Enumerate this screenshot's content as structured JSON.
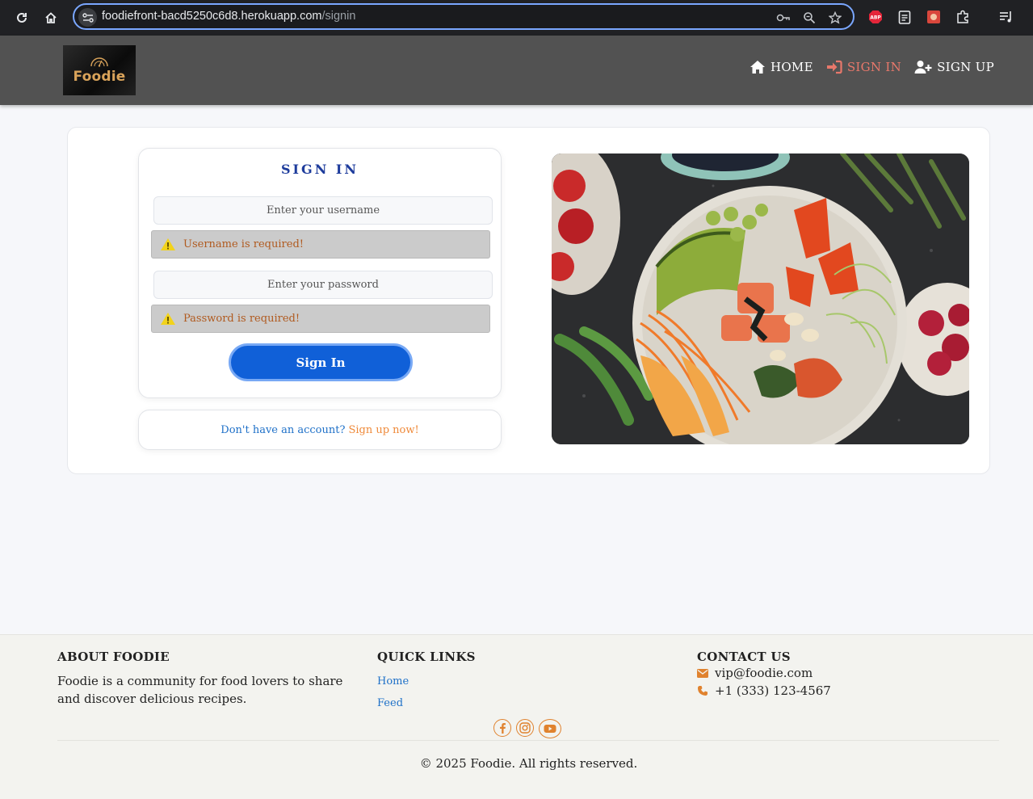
{
  "browser": {
    "url_host": "foodiefront-bacd5250c6d8.herokuapp.com",
    "url_path": "/signin",
    "extensions": [
      "adblock-icon",
      "notes-icon",
      "extension-red-icon",
      "puzzle-icon",
      "media-icon"
    ]
  },
  "header": {
    "logo_text": "Foodie",
    "nav": [
      {
        "label": "HOME",
        "icon": "home-icon",
        "active": false
      },
      {
        "label": "SIGN IN",
        "icon": "sign-in-icon",
        "active": true
      },
      {
        "label": "SIGN UP",
        "icon": "user-plus-icon",
        "active": false
      }
    ]
  },
  "signin": {
    "title": "SIGN IN",
    "username_placeholder": "Enter your username",
    "username_error": "Username is required!",
    "password_placeholder": "Enter your password",
    "password_error": "Password is required!",
    "submit_label": "Sign In",
    "signup_prompt": "Don't have an account?",
    "signup_link": "Sign up now!"
  },
  "footer": {
    "about_heading": "ABOUT FOODIE",
    "about_text": "Foodie is a community for food lovers to share and discover delicious recipes.",
    "links_heading": "QUICK LINKS",
    "links": [
      "Home",
      "Feed"
    ],
    "contact_heading": "CONTACT US",
    "email": "vip@foodie.com",
    "phone": "+1 (333) 123-4567",
    "socials": [
      "facebook-icon",
      "instagram-icon",
      "youtube-icon"
    ],
    "copyright": "© 2025 Foodie. All rights reserved."
  },
  "colors": {
    "header_bg": "#525252",
    "active_nav": "#e8786b",
    "primary_button": "#1060d8",
    "accent_orange": "#ef8a3a",
    "title_blue": "#1e3c9c"
  }
}
